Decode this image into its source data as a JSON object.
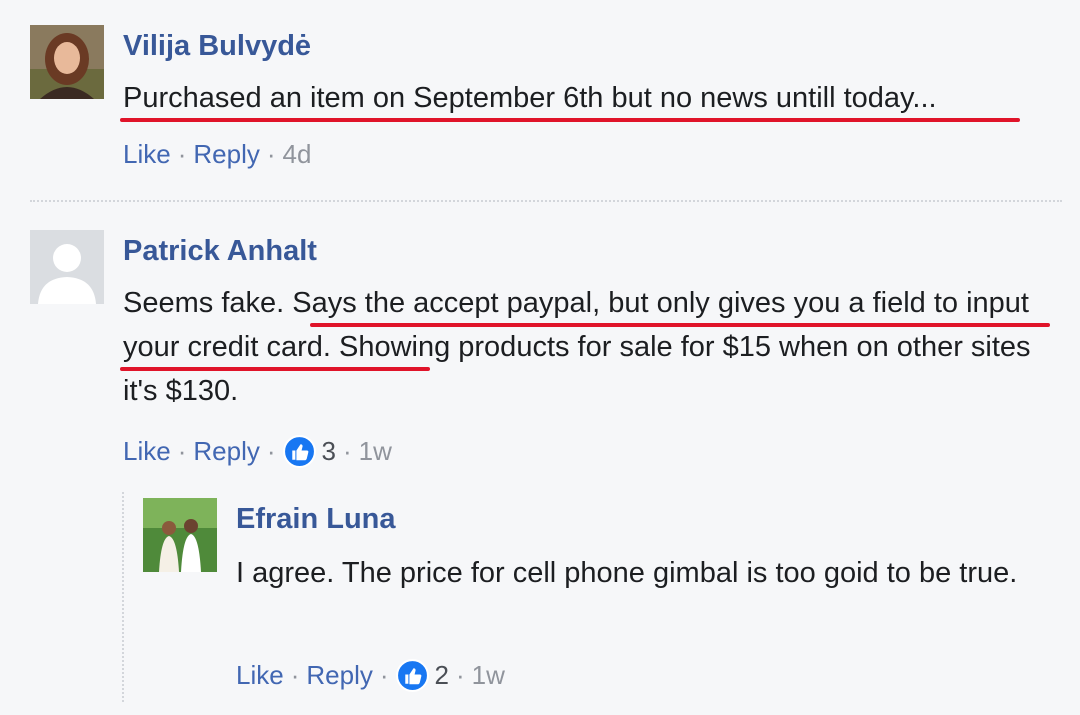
{
  "comments": [
    {
      "author": "Vilija Bulvydė",
      "text": "Purchased an item on September 6th but no news untill today...",
      "actions": {
        "like": "Like",
        "reply": "Reply",
        "time": "4d"
      }
    },
    {
      "author": "Patrick Anhalt",
      "text": "Seems fake. Says the accept paypal, but only gives you a field to input your credit card. Showing products for sale for $15 when on other sites it's $130.",
      "actions": {
        "like": "Like",
        "reply": "Reply",
        "reactions": "3",
        "time": "1w"
      }
    },
    {
      "author": "Efrain Luna",
      "text": "I agree. The price for cell phone gimbal is too goid to be true.",
      "actions": {
        "like": "Like",
        "reply": "Reply",
        "reactions": "2",
        "time": "1w"
      }
    }
  ],
  "separator": "·",
  "colors": {
    "author": "#385898",
    "link": "#4267b2",
    "meta": "#90949c",
    "text": "#1c1e21",
    "highlight": "#e0142a",
    "background": "#f6f7f9",
    "like_reaction": "#1877f2"
  },
  "icons": {
    "reaction": "thumbs-up-icon",
    "default_avatar": "default-avatar-icon"
  }
}
